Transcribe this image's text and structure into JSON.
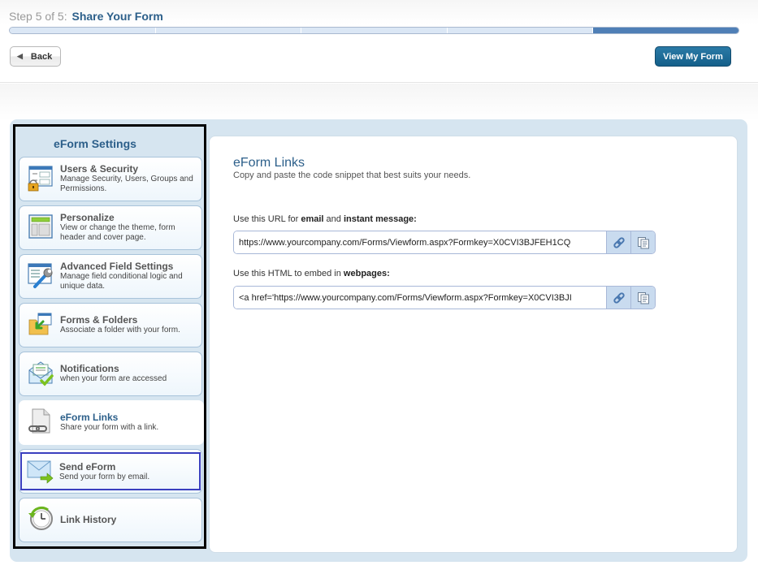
{
  "header": {
    "step_prefix": "Step 5 of 5:",
    "step_name": "Share Your Form",
    "progress": {
      "current_step": 5,
      "total_steps": 5
    },
    "back_label": "Back",
    "view_form_label": "View My Form"
  },
  "sidebar": {
    "title": "eForm Settings",
    "items": [
      {
        "label": "Users & Security",
        "desc": "Manage Security, Users, Groups and Permissions.",
        "icon": "users-security-icon"
      },
      {
        "label": "Personalize",
        "desc": "View or change the theme, form header and cover page.",
        "icon": "personalize-icon"
      },
      {
        "label": "Advanced Field Settings",
        "desc": "Manage field conditional logic and unique data.",
        "icon": "advanced-field-settings-icon"
      },
      {
        "label": "Forms & Folders",
        "desc": "Associate a folder with your form.",
        "icon": "folder-icon"
      },
      {
        "label": "Notifications",
        "desc": "when your form are accessed",
        "icon": "notifications-icon"
      },
      {
        "label": "eForm Links",
        "desc": "Share your form with a link.",
        "icon": "link-document-icon",
        "active": true
      },
      {
        "label": "Send eForm",
        "desc": "Send your form by email.",
        "icon": "send-email-icon",
        "focused": true
      },
      {
        "label": "Link History",
        "desc": "",
        "icon": "history-clock-icon"
      }
    ]
  },
  "content": {
    "title": "eForm Links",
    "subtitle": "Copy and paste the code snippet that best suits your needs.",
    "url_field": {
      "label_prefix": "Use this URL for ",
      "label_bold1": "email",
      "label_mid": " and ",
      "label_bold2": "instant message:",
      "value": "https://www.yourcompany.com/Forms/Viewform.aspx?Formkey=X0CVI3BJFEH1CQ"
    },
    "html_field": {
      "label_prefix": "Use this HTML to embed in ",
      "label_bold": "webpages:",
      "value": "<a href='https://www.yourcompany.com/Forms/Viewform.aspx?Formkey=X0CVI3BJI"
    }
  },
  "colors": {
    "accent": "#2c5f8a",
    "progress_done": "#4f7fb6",
    "progress_todo": "#dbe7f5",
    "panel_bg": "#d6e5f0",
    "primary_button": "#145f8a",
    "focus_border": "#3a3fbf"
  }
}
